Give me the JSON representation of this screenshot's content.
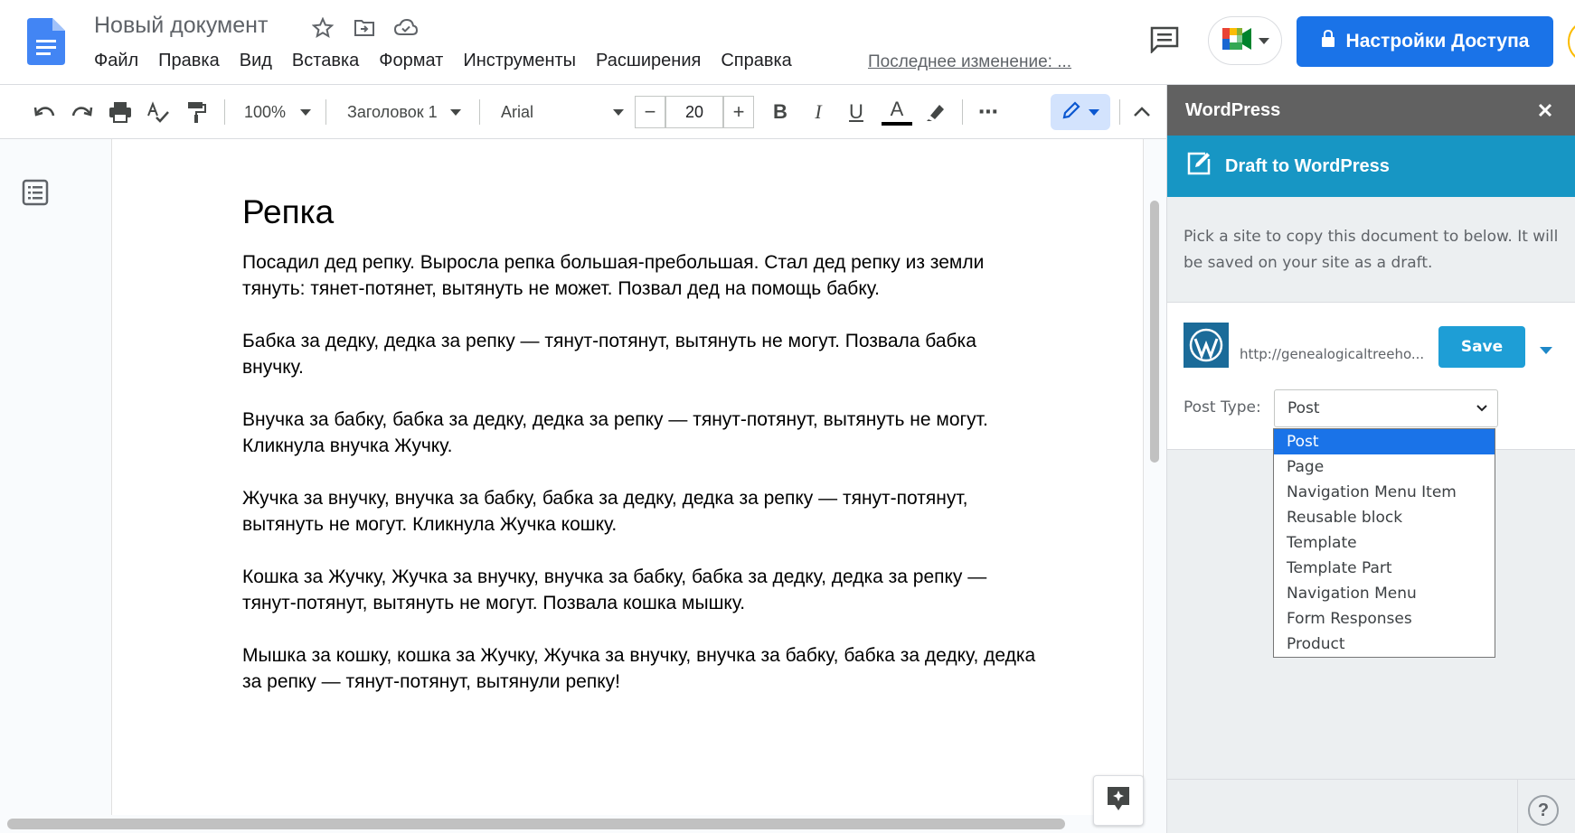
{
  "header": {
    "doc_title": "Новый документ",
    "menu": [
      "Файл",
      "Правка",
      "Вид",
      "Вставка",
      "Формат",
      "Инструменты",
      "Расширения",
      "Справка"
    ],
    "last_edit": "Последнее изменение: ...",
    "share_label": "Настройки Доступа",
    "icons": [
      "docs-logo",
      "star-icon",
      "move-to-folder-icon",
      "cloud-saved-icon",
      "comments-icon",
      "meet-icon",
      "lock-icon"
    ]
  },
  "toolbar": {
    "zoom": "100%",
    "style": "Заголовок 1",
    "font": "Arial",
    "font_size": "20",
    "decrease_label": "−",
    "increase_label": "+",
    "bold_label": "B",
    "italic_label": "I",
    "underline_label": "U",
    "text_color_label": "A",
    "more_label": "⋯",
    "text_color": "#000000"
  },
  "document": {
    "heading": "Репка",
    "paragraphs": [
      "Посадил дед репку. Выросла репка большая-пребольшая. Стал дед репку из земли тянуть: тянет-потянет, вытянуть не может. Позвал дед на помощь бабку.",
      "Бабка за дедку, дедка за репку — тянут-потянут, вытянуть не могут. Позвала бабка внучку.",
      "Внучка за бабку, бабка за дедку, дедка за репку — тянут-потянут, вытянуть не могут. Кликнула внучка Жучку.",
      "Жучка за внучку, внучка за бабку, бабка за дедку, дедка за репку — тянут-потянут, вытянуть не могут. Кликнула Жучка кошку.",
      "Кошка за Жучку, Жучка за внучку, внучка за бабку, бабка за дедку, дедка за репку — тянут-потянут, вытянуть не могут. Позвала кошка мышку.",
      "Мышка за кошку, кошка за Жучку, Жучка за внучку, внучка за бабку, бабка за дедку, дедка за репку — тянут-потянут, вытянули репку!"
    ]
  },
  "sidebar": {
    "title": "WordPress",
    "banner": "Draft to WordPress",
    "description": "Pick a site to copy this document to below. It will be saved on your site as a draft.",
    "site_url": "http://genealogicaltreeho...",
    "save_label": "Save",
    "post_type_label": "Post Type:",
    "post_type_value": "Post",
    "post_type_options": [
      "Post",
      "Page",
      "Navigation Menu Item",
      "Reusable block",
      "Template",
      "Template Part",
      "Navigation Menu",
      "Form Responses",
      "Product"
    ],
    "help_label": "?"
  },
  "colors": {
    "share_button": "#1a73e8",
    "sidebar_header": "#616161",
    "sidebar_banner": "#1796c4",
    "save_button": "#1e9ed6",
    "selected_option": "#1a73e8"
  }
}
